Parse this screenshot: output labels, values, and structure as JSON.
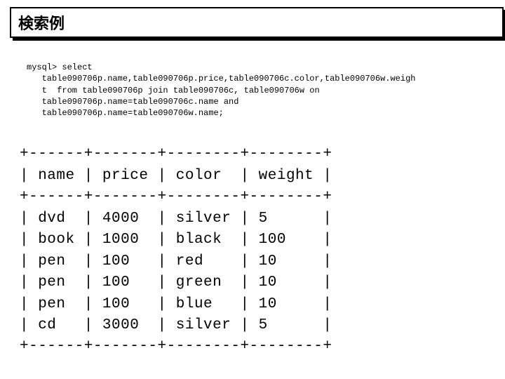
{
  "title": "検索例",
  "sql": {
    "l1": "mysql> select",
    "l2": "   table090706p.name,table090706p.price,table090706c.color,table090706w.weigh",
    "l3": "   t  from table090706p join table090706c, table090706w on",
    "l4": "   table090706p.name=table090706c.name and",
    "l5": "   table090706p.name=table090706w.name;"
  },
  "table": {
    "sep": "+------+-------+--------+--------+",
    "header": "| name | price | color  | weight |",
    "r1": "| dvd  | 4000  | silver | 5      |",
    "r2": "| book | 1000  | black  | 100    |",
    "r3": "| pen  | 100   | red    | 10     |",
    "r4": "| pen  | 100   | green  | 10     |",
    "r5": "| pen  | 100   | blue   | 10     |",
    "r6": "| cd   | 3000  | silver | 5      |"
  },
  "chart_data": {
    "type": "table",
    "title": "検索例",
    "columns": [
      "name",
      "price",
      "color",
      "weight"
    ],
    "rows": [
      {
        "name": "dvd",
        "price": 4000,
        "color": "silver",
        "weight": 5
      },
      {
        "name": "book",
        "price": 1000,
        "color": "black",
        "weight": 100
      },
      {
        "name": "pen",
        "price": 100,
        "color": "red",
        "weight": 10
      },
      {
        "name": "pen",
        "price": 100,
        "color": "green",
        "weight": 10
      },
      {
        "name": "pen",
        "price": 100,
        "color": "blue",
        "weight": 10
      },
      {
        "name": "cd",
        "price": 3000,
        "color": "silver",
        "weight": 5
      }
    ]
  }
}
